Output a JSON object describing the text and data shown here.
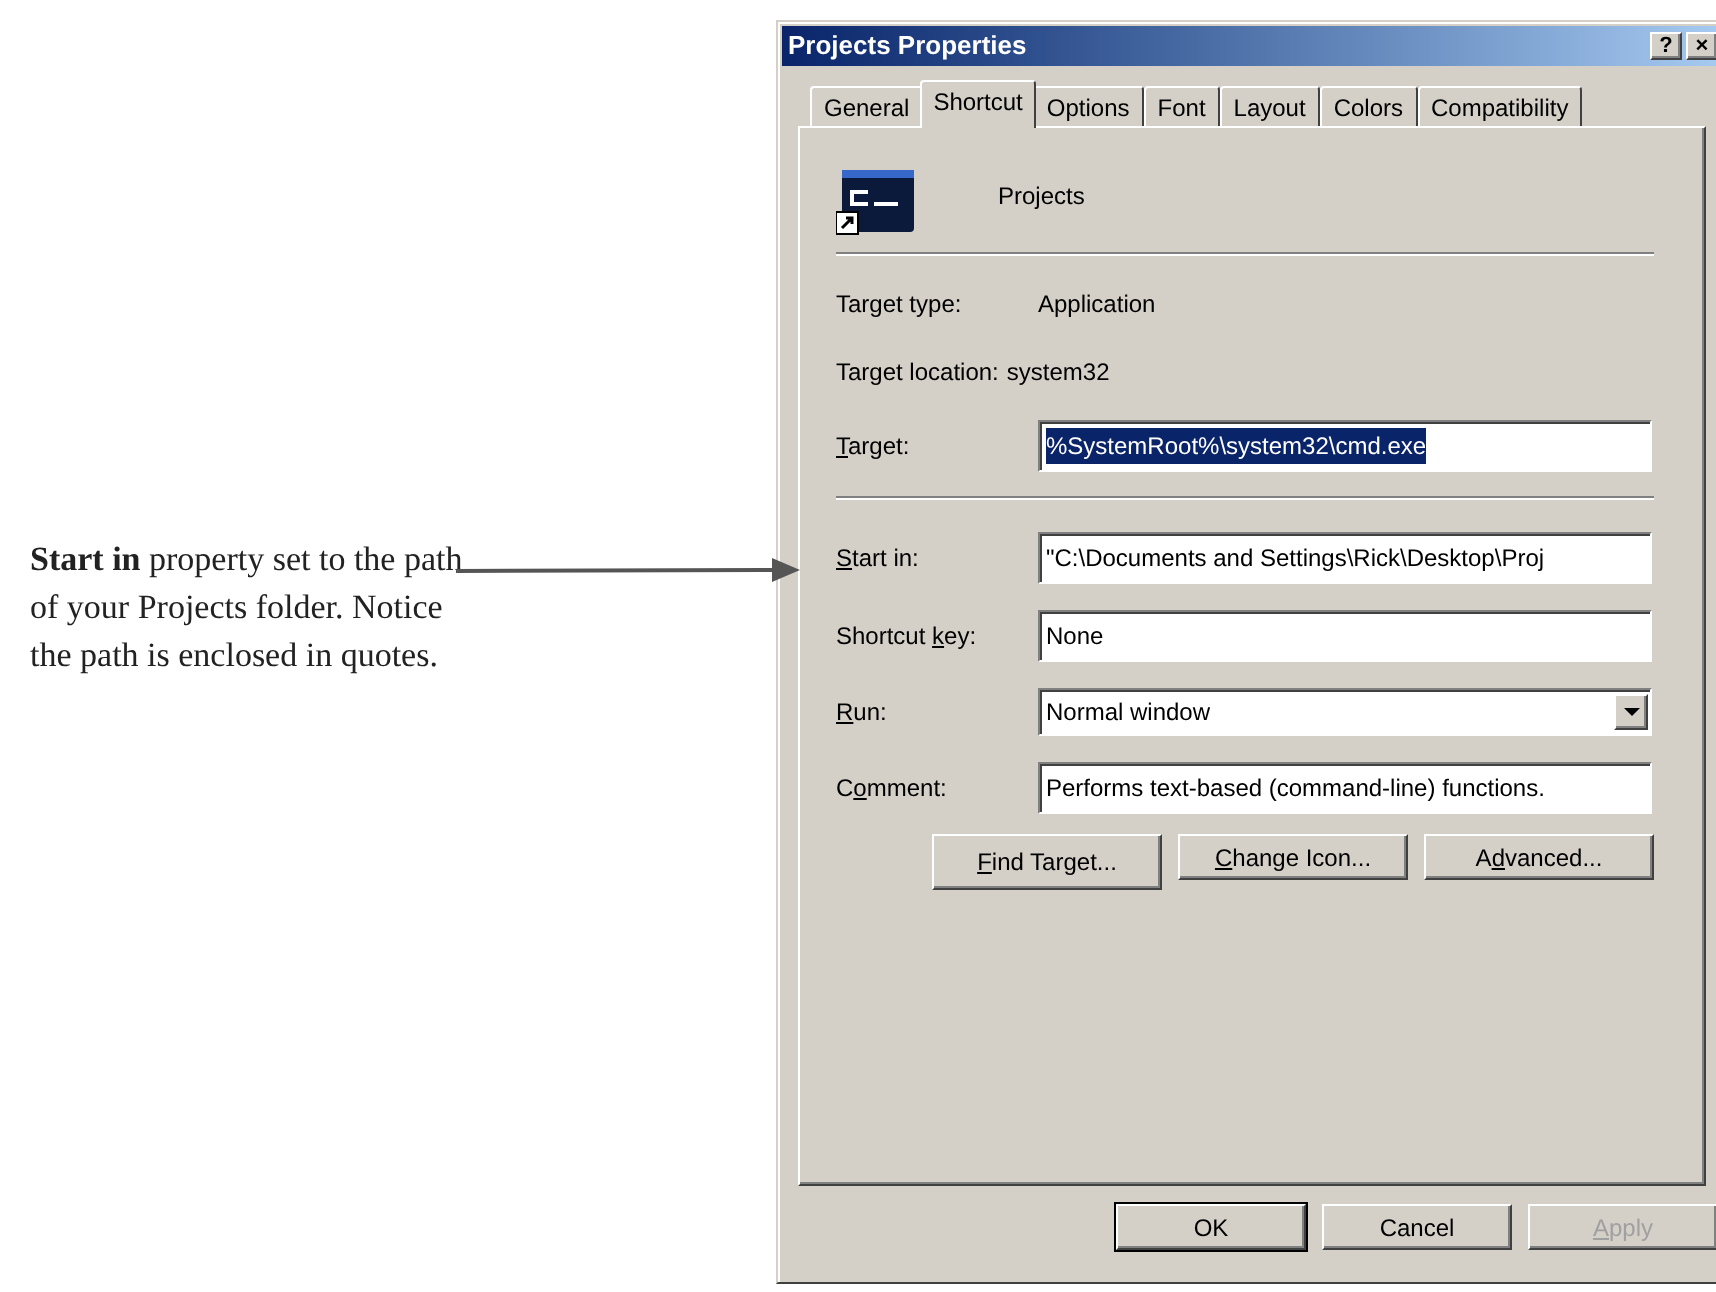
{
  "annotation": {
    "text": "**Start in** property set to the path of your Projects folder. Notice the path is enclosed in quotes."
  },
  "window": {
    "title": "Projects Properties",
    "title_buttons": [
      "?",
      "×"
    ]
  },
  "tabs": [
    {
      "label": "General",
      "selected": false
    },
    {
      "label": "Shortcut",
      "selected": true
    },
    {
      "label": "Options",
      "selected": false
    },
    {
      "label": "Font",
      "selected": false
    },
    {
      "label": "Layout",
      "selected": false
    },
    {
      "label": "Colors",
      "selected": false
    },
    {
      "label": "Compatibility",
      "selected": false
    }
  ],
  "shortcut_name": "Projects",
  "info": [
    {
      "label": "Target type:",
      "value": "Application"
    },
    {
      "label": "Target location:",
      "value": "system32"
    }
  ],
  "target": {
    "label": {
      "key": "T",
      "post": "arget:"
    },
    "value": "%SystemRoot%\\system32\\cmd.exe",
    "selected": true
  },
  "fields": [
    {
      "kind": "text",
      "label": {
        "key": "S",
        "post": "tart in:"
      },
      "value": "\"C:\\Documents and Settings\\Rick\\Desktop\\Proj"
    },
    {
      "kind": "text",
      "label": {
        "pre": "Shortcut ",
        "key": "k",
        "post": "ey:"
      },
      "value": "None"
    },
    {
      "kind": "dropdown",
      "label": {
        "key": "R",
        "post": "un:"
      },
      "value": "Normal window"
    },
    {
      "kind": "text",
      "label": {
        "pre": "C",
        "key": "o",
        "post": "mment:"
      },
      "value": "Performs text-based (command-line) functions."
    }
  ],
  "actions": [
    {
      "key": "F",
      "post": "ind Target..."
    },
    {
      "key": "C",
      "post": "hange Icon..."
    },
    {
      "pre": "A",
      "key": "d",
      "post": "vanced..."
    }
  ],
  "buttons": [
    {
      "label": {
        "pre": "OK"
      },
      "default": true,
      "disabled": false
    },
    {
      "label": {
        "pre": "Cancel"
      },
      "default": false,
      "disabled": false
    },
    {
      "label": {
        "key": "A",
        "post": "pply"
      },
      "default": false,
      "disabled": true
    }
  ]
}
